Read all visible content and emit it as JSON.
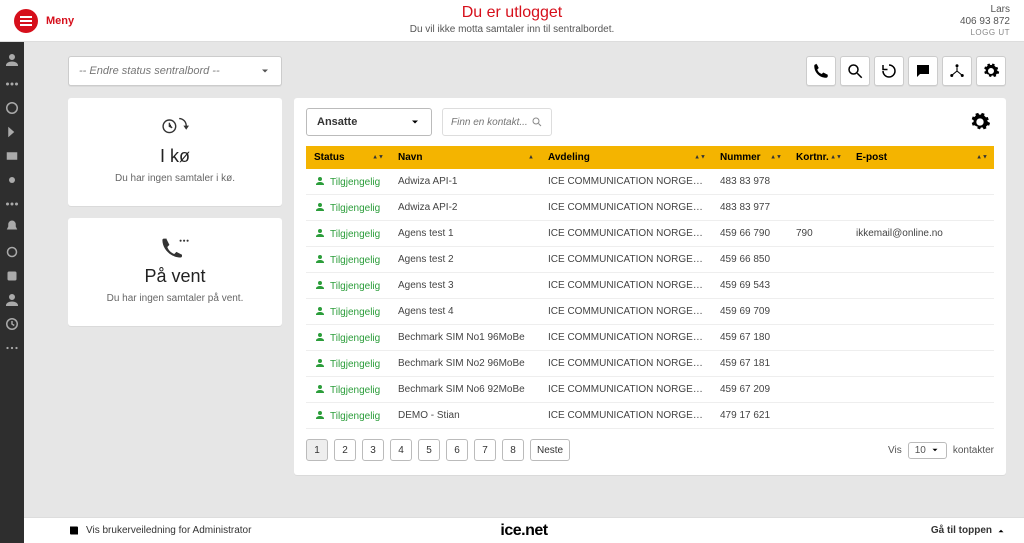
{
  "header": {
    "menu_label": "Meny",
    "title": "Du er utlogget",
    "subtitle": "Du vil ikke motta samtaler inn til sentralbordet.",
    "user_name": "Lars",
    "user_phone": "406 93 872",
    "logout_label": "LOGG UT"
  },
  "status_select": {
    "placeholder": "-- Endre status sentralbord --"
  },
  "cards": {
    "queue": {
      "title": "I kø",
      "subtitle": "Du har ingen samtaler i kø."
    },
    "hold": {
      "title": "På vent",
      "subtitle": "Du har ingen samtaler på vent."
    }
  },
  "filters": {
    "category_label": "Ansatte",
    "search_placeholder": "Finn en kontakt..."
  },
  "columns": {
    "status": "Status",
    "name": "Navn",
    "department": "Avdeling",
    "number": "Nummer",
    "short": "Kortnr.",
    "email": "E-post"
  },
  "rows": [
    {
      "status": "Tilgjengelig",
      "name": "Adwiza API-1",
      "department": "ICE COMMUNICATION NORGE AS",
      "number": "483 83 978",
      "short": "",
      "email": ""
    },
    {
      "status": "Tilgjengelig",
      "name": "Adwiza API-2",
      "department": "ICE COMMUNICATION NORGE AS",
      "number": "483 83 977",
      "short": "",
      "email": ""
    },
    {
      "status": "Tilgjengelig",
      "name": "Agens test 1",
      "department": "ICE COMMUNICATION NORGE AS",
      "number": "459 66 790",
      "short": "790",
      "email": "ikkemail@online.no"
    },
    {
      "status": "Tilgjengelig",
      "name": "Agens test 2",
      "department": "ICE COMMUNICATION NORGE AS",
      "number": "459 66 850",
      "short": "",
      "email": ""
    },
    {
      "status": "Tilgjengelig",
      "name": "Agens test 3",
      "department": "ICE COMMUNICATION NORGE AS",
      "number": "459 69 543",
      "short": "",
      "email": ""
    },
    {
      "status": "Tilgjengelig",
      "name": "Agens test 4",
      "department": "ICE COMMUNICATION NORGE AS",
      "number": "459 69 709",
      "short": "",
      "email": ""
    },
    {
      "status": "Tilgjengelig",
      "name": "Bechmark SIM No1 96MoBe",
      "department": "ICE COMMUNICATION NORGE AS",
      "number": "459 67 180",
      "short": "",
      "email": ""
    },
    {
      "status": "Tilgjengelig",
      "name": "Bechmark SIM No2 96MoBe",
      "department": "ICE COMMUNICATION NORGE AS",
      "number": "459 67 181",
      "short": "",
      "email": ""
    },
    {
      "status": "Tilgjengelig",
      "name": "Bechmark SIM No6 92MoBe",
      "department": "ICE COMMUNICATION NORGE AS",
      "number": "459 67 209",
      "short": "",
      "email": ""
    },
    {
      "status": "Tilgjengelig",
      "name": "DEMO - Stian",
      "department": "ICE COMMUNICATION NORGE AS",
      "number": "479 17 621",
      "short": "",
      "email": ""
    }
  ],
  "pager": {
    "pages": [
      "1",
      "2",
      "3",
      "4",
      "5",
      "6",
      "7",
      "8"
    ],
    "next_label": "Neste",
    "show_label": "Vis",
    "per_page": "10",
    "contacts_label": "kontakter"
  },
  "footer": {
    "help_label": "Vis brukerveiledning for Administrator",
    "brand": "ice.net",
    "totop_label": "Gå til toppen"
  }
}
